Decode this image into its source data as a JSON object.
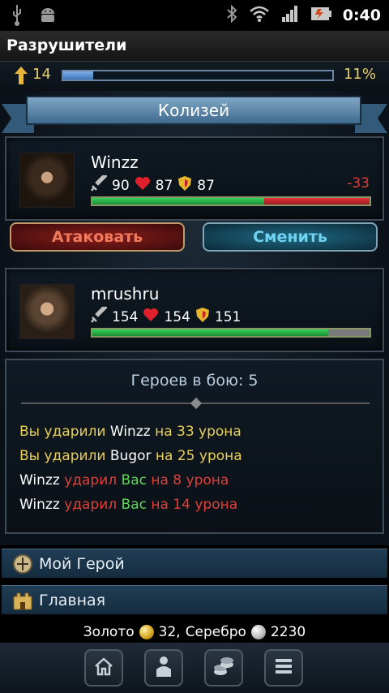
{
  "status_bar": {
    "time": "0:40"
  },
  "app": {
    "title": "Разрушители"
  },
  "player": {
    "level": "14",
    "xp_percent_label": "11%",
    "xp_fraction": 0.11
  },
  "arena": {
    "title": "Колизей"
  },
  "opponent": {
    "name": "Winzz",
    "attack": "90",
    "health": "87",
    "defense": "87",
    "damage_delta": "-33",
    "hp_fraction": 0.62
  },
  "actions": {
    "attack_label": "Атаковать",
    "change_label": "Сменить"
  },
  "me": {
    "name": "mrushru",
    "attack": "154",
    "health": "154",
    "defense": "151",
    "hp_fraction": 0.85
  },
  "battle": {
    "heroes_label": "Героев в бою: 5",
    "log": [
      {
        "a": "Вы ударили",
        "b": "Winzz",
        "c": "на 33 урона"
      },
      {
        "a": "Вы ударили",
        "b": "Bugor",
        "c": "на 25 урона"
      },
      {
        "a": "Winzz",
        "b": "ударил",
        "c": "Вас",
        "d": "на 8 урона"
      },
      {
        "a": "Winzz",
        "b": "ударил",
        "c": "Вас",
        "d": "на 14 урона"
      }
    ]
  },
  "nav": {
    "my_hero": "Мой Герой",
    "home": "Главная"
  },
  "currency": {
    "gold_label": "Золото",
    "gold": "32,",
    "silver_label": "Серебро",
    "silver": "2230"
  },
  "icons": {
    "status": [
      "usb-icon",
      "android-icon",
      "bluetooth-icon",
      "wifi-icon",
      "signal-icon",
      "battery-icon"
    ],
    "toolbar": [
      "home-icon",
      "person-icon",
      "coins-icon",
      "menu-icon"
    ]
  }
}
